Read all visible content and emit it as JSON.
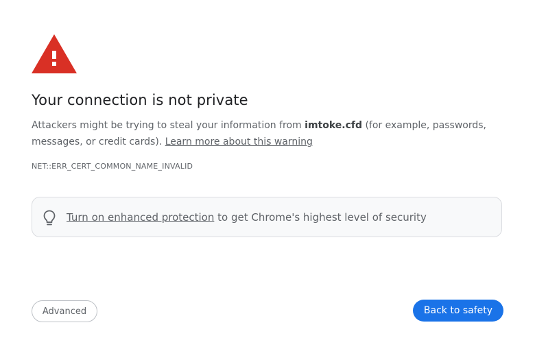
{
  "heading": "Your connection is not private",
  "message": {
    "before": "Attackers might be trying to steal your information from ",
    "domain": "imtoke.cfd",
    "after": " (for example, passwords, messages, or credit cards). ",
    "learn_more": "Learn more about this warning"
  },
  "error_code": "NET::ERR_CERT_COMMON_NAME_INVALID",
  "promo": {
    "link_text": "Turn on enhanced protection",
    "rest": " to get Chrome's highest level of security"
  },
  "buttons": {
    "advanced": "Advanced",
    "back_to_safety": "Back to safety"
  },
  "icons": {
    "warning": "warning-triangle-icon",
    "bulb": "lightbulb-icon"
  },
  "colors": {
    "warning_red": "#D93025",
    "primary_blue": "#1A73E8"
  }
}
